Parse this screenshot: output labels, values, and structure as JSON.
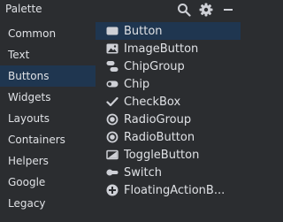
{
  "header": {
    "title": "Palette",
    "search_icon": "search-icon",
    "settings_icon": "gear-icon",
    "minimize_icon": "minimize-icon"
  },
  "categories": [
    {
      "label": "Common"
    },
    {
      "label": "Text"
    },
    {
      "label": "Buttons",
      "selected": true
    },
    {
      "label": "Widgets"
    },
    {
      "label": "Layouts"
    },
    {
      "label": "Containers"
    },
    {
      "label": "Helpers"
    },
    {
      "label": "Google"
    },
    {
      "label": "Legacy"
    }
  ],
  "items": [
    {
      "label": "Button",
      "icon": "button-icon",
      "selected": true
    },
    {
      "label": "ImageButton",
      "icon": "image-button-icon"
    },
    {
      "label": "ChipGroup",
      "icon": "chip-group-icon"
    },
    {
      "label": "Chip",
      "icon": "chip-icon"
    },
    {
      "label": "CheckBox",
      "icon": "checkmark-icon"
    },
    {
      "label": "RadioGroup",
      "icon": "radio-group-icon"
    },
    {
      "label": "RadioButton",
      "icon": "radio-button-icon"
    },
    {
      "label": "ToggleButton",
      "icon": "toggle-button-icon"
    },
    {
      "label": "Switch",
      "icon": "switch-icon"
    },
    {
      "label": "FloatingActionB...",
      "icon": "fab-plus-icon"
    }
  ],
  "colors": {
    "background": "#2b2d30",
    "selection": "#1f3650",
    "text": "#dfe1e5",
    "icon": "#ced0d6"
  }
}
